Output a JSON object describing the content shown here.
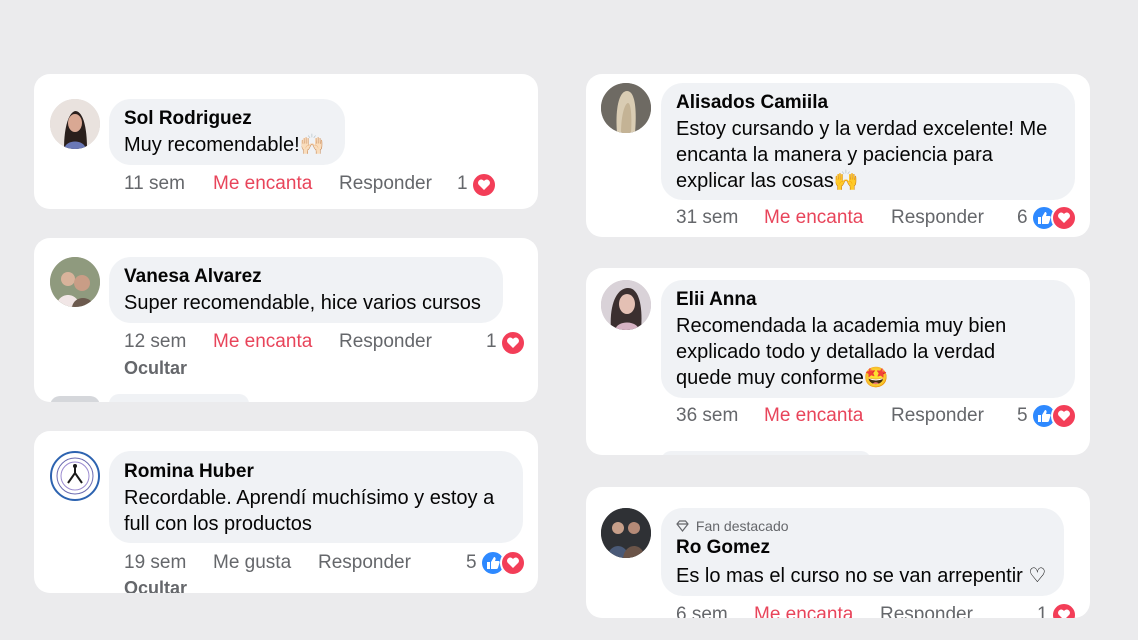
{
  "comments": [
    {
      "name": "Sol Rodriguez",
      "text": [
        "Muy recomendable!🙌🏻"
      ],
      "time": "11 sem",
      "react": "Me encanta",
      "reply": "Responder",
      "count": "1"
    },
    {
      "name": "Vanesa Alvarez",
      "text": [
        "Super recomendable, hice varios cursos"
      ],
      "time": "12 sem",
      "react": "Me encanta",
      "reply": "Responder",
      "count": "1",
      "hide": "Ocultar"
    },
    {
      "name": "Romina Huber",
      "text": [
        "Recordable. Aprendí muchísimo y estoy a",
        "full con los productos"
      ],
      "time": "19 sem",
      "react": "Me gusta",
      "reply": "Responder",
      "count": "5",
      "hide": "Ocultar"
    },
    {
      "name": "Alisados Camiila",
      "text": [
        "Estoy cursando y la verdad excelente! Me",
        "encanta la manera y paciencia para",
        "explicar las cosas🙌"
      ],
      "time": "31 sem",
      "react": "Me encanta",
      "reply": "Responder",
      "count": "6"
    },
    {
      "name": "Elii Anna",
      "text": [
        "Recomendada la academia muy bien",
        "explicado todo y detallado la verdad",
        "quede muy conforme🤩"
      ],
      "time": "36 sem",
      "react": "Me encanta",
      "reply": "Responder",
      "count": "5"
    },
    {
      "name": "Ro Gomez",
      "badge": "Fan destacado",
      "text": [
        "Es lo mas el curso no se van arrepentir ♡"
      ],
      "time": "6 sem",
      "react": "Me encanta",
      "reply": "Responder",
      "count": "1"
    }
  ],
  "colors": {
    "accent": "#e8445a",
    "like": "#2e89ff",
    "heart": "#f33e58",
    "bubble": "#f0f2f5",
    "muted": "#65676b"
  }
}
